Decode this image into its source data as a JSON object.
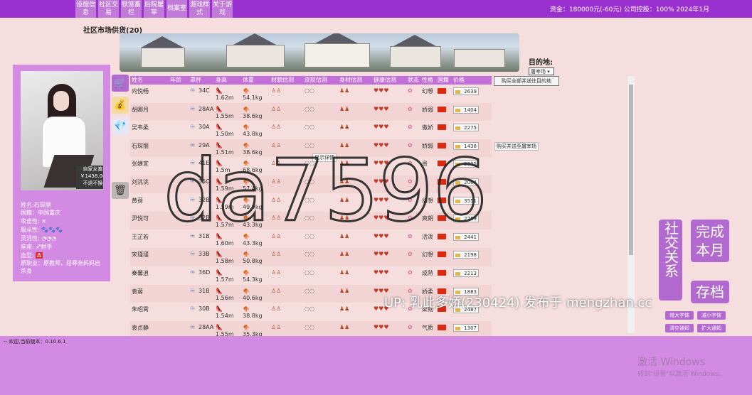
{
  "menu": [
    "设施信息",
    "社区交易",
    "铁笼畜栏",
    "后院屠宰",
    "档案室",
    "游戏样式",
    "关于游戏"
  ],
  "status": "资金：180000元(-60元) 公司控股：100% 2024年1月",
  "market_title": "社区市场供货(20)",
  "profile": {
    "tag_title": "自家女畜",
    "tag_price": "￥1438.00",
    "tag_note": "不退不换",
    "name": "姓名:石琛丽",
    "region": "国籍：中国重庆",
    "attack": "攻击性:",
    "obedience": "服从性:",
    "agility": "灵活性:",
    "star": "星座:",
    "star_value": "射手",
    "blood": "血型:",
    "blood_value": "A",
    "job": "原职业：原教师，屈辱亲妈妈自杀身",
    "job2": ""
  },
  "headers": [
    "姓名",
    "年龄",
    "罩杯",
    "身高",
    "体重",
    "材貌估测",
    "皮肤估测",
    "身材估测",
    "健康估测",
    "状态",
    "性格",
    "国籍",
    "价格"
  ],
  "destination": {
    "label": "目的地:",
    "selected": "屠宰场",
    "buy_all": "购买全部并送往目的地"
  },
  "rows": [
    {
      "name": "向悦畅",
      "cup": "34C",
      "height": "1.62m",
      "weight": "54.1kg",
      "trait": "幻想",
      "price": "2639",
      "btn": ""
    },
    {
      "name": "胡卿月",
      "cup": "28AA",
      "height": "1.55m",
      "weight": "38.6kg",
      "trait": "娇弱",
      "price": "1404",
      "btn": ""
    },
    {
      "name": "吴韦柔",
      "cup": "30A",
      "height": "1.50m",
      "weight": "43.8kg",
      "trait": "傲娇",
      "price": "2275",
      "btn": ""
    },
    {
      "name": "石琛丽",
      "cup": "29A",
      "height": "1.51m",
      "weight": "38.6kg",
      "trait": "娇弱",
      "price": "1438",
      "btn": "购买并送至屠宰场"
    },
    {
      "name": "张婕宜",
      "cup": "41E",
      "height": "1.5m",
      "weight": "68.6kg",
      "trait": "贵",
      "price": "2305",
      "btn": "显示详情"
    },
    {
      "name": "刘洮洮",
      "cup": "35C",
      "height": "1.59m",
      "weight": "57.4kg",
      "trait": "",
      "price": "2064",
      "btn": ""
    },
    {
      "name": "黄蓓",
      "cup": "32B",
      "height": "1.59m",
      "weight": "49.9kg",
      "trait": "幻想",
      "price": "3551",
      "btn": ""
    },
    {
      "name": "尹悦可",
      "cup": "32B",
      "height": "1.57m",
      "weight": "43.3kg",
      "trait": "爽朗",
      "price": "2759",
      "btn": ""
    },
    {
      "name": "王芷若",
      "cup": "31B",
      "height": "1.60m",
      "weight": "43.3kg",
      "trait": "活泼",
      "price": "2441",
      "btn": ""
    },
    {
      "name": "宋瑾瑾",
      "cup": "33B",
      "height": "1.58m",
      "weight": "50.8kg",
      "trait": "幻想",
      "price": "2198",
      "btn": ""
    },
    {
      "name": "秦馨逍",
      "cup": "36D",
      "height": "1.57m",
      "weight": "54.3kg",
      "trait": "成熟",
      "price": "2213",
      "btn": ""
    },
    {
      "name": "袁蓉",
      "cup": "31B",
      "height": "1.56m",
      "weight": "40.6kg",
      "trait": "娇柔",
      "price": "1883",
      "btn": ""
    },
    {
      "name": "朱昭霄",
      "cup": "30B",
      "height": "1.54m",
      "weight": "38.8kg",
      "trait": "柔韧",
      "price": "2487",
      "btn": ""
    },
    {
      "name": "袁贞静",
      "cup": "28AA",
      "height": "1.55m",
      "weight": "35.3kg",
      "trait": "气质",
      "price": "1307",
      "btn": ""
    }
  ],
  "right_buttons": {
    "social": "社交关系",
    "finish": "完成本月",
    "save": "存档",
    "font_up": "增大字体",
    "font_down": "减小字体",
    "clear": "清空通知",
    "expand": "扩大通知"
  },
  "version": "-- 欢迎,当前版本：0.10.6.1",
  "activate_title": "激活 Windows",
  "activate_sub": "转到\"设置\"以激活 Windows。",
  "watermark": "da7596",
  "uploader": "UP: 乳此多娇(230424) 发布于 mengzhan.cc",
  "colors": {
    "topbar": "#9b30d0",
    "panel": "#d28ae2",
    "header": "#c36fd8",
    "button": "#b26ad0"
  }
}
